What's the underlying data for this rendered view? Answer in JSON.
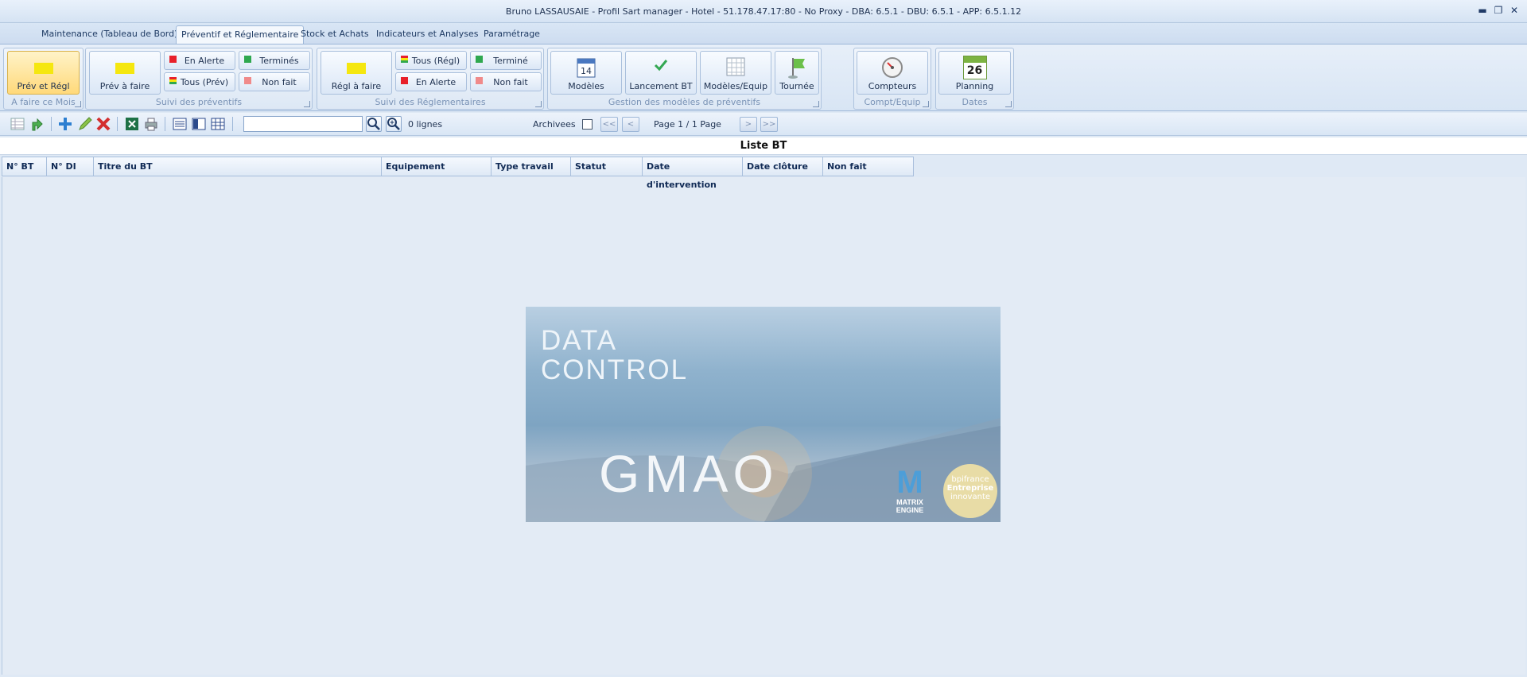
{
  "window": {
    "title": "Bruno LASSAUSAIE - Profil Sart manager - Hotel - 51.178.47.17:80 - No Proxy - DBA: 6.5.1 - DBU: 6.5.1 - APP: 6.5.1.12"
  },
  "tabs": [
    {
      "label": "Maintenance (Tableau de Bord)"
    },
    {
      "label": "Préventif et Réglementaire"
    },
    {
      "label": "Stock et Achats"
    },
    {
      "label": "Indicateurs et Analyses"
    },
    {
      "label": "Paramétrage"
    }
  ],
  "ribbon": {
    "g1": {
      "label": "A faire ce Mois",
      "btn": "Prév et Régl"
    },
    "g2": {
      "label": "Suivi des préventifs",
      "btn": "Prév à faire",
      "en_alerte": "En Alerte",
      "tous_prev": "Tous (Prév)",
      "termines": "Terminés",
      "non_fait": "Non fait"
    },
    "g3": {
      "label": "Suivi des Réglementaires",
      "btn": "Régl à faire",
      "tous_regl": "Tous (Régl)",
      "en_alerte": "En Alerte",
      "termine": "Terminé",
      "non_fait": "Non fait"
    },
    "g4": {
      "label": "Gestion des modèles de préventifs",
      "modeles": "Modèles",
      "lancement": "Lancement BT",
      "modeles_equip": "Modèles/Equip",
      "tournee": "Tournée"
    },
    "g5": {
      "label": "Compt/Equip",
      "btn": "Compteurs"
    },
    "g6": {
      "label": "Dates",
      "btn": "Planning",
      "day": "26"
    }
  },
  "toolbar": {
    "search_value": "",
    "count": "0 lignes",
    "archives": "Archivees",
    "page": "Page 1 / 1 Page",
    "first": "<<",
    "prev": "<",
    "next": ">",
    "last": ">>"
  },
  "list": {
    "title": "Liste BT",
    "columns": [
      "N° BT",
      "N° DI",
      "Titre du BT",
      "Equipement",
      "Type travail",
      "Statut",
      "Date d'intervention",
      "Date clôture",
      "Non fait"
    ]
  },
  "splash": {
    "line1": "DATA",
    "line2": "CONTROL",
    "product": "GMAO",
    "logo_m": "M",
    "logo_text1": "MATRIX",
    "logo_text2": "ENGINE",
    "bpi1": "bpifrance",
    "bpi2": "Entreprise",
    "bpi3": "innovante"
  },
  "colors": {
    "accent": "#f5e70f",
    "red": "#e8202a",
    "green": "#2fa84f",
    "pink": "#f08a8a"
  }
}
